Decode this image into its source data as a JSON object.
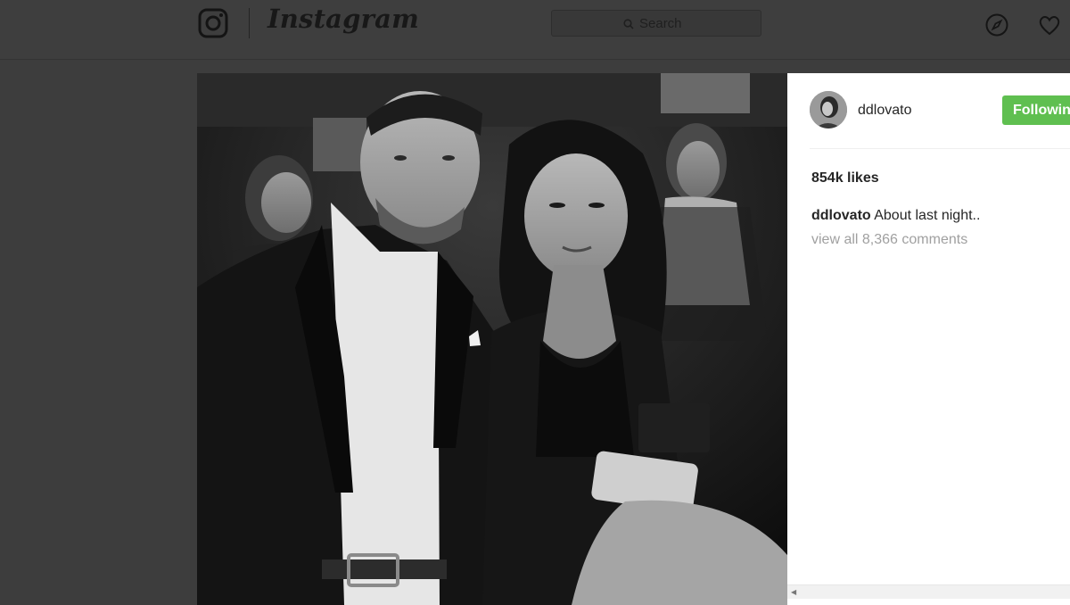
{
  "topnav": {
    "brand": "Instagram",
    "search_placeholder": "Search",
    "icons": [
      "instagram-camera-icon",
      "search-icon",
      "compass-icon",
      "heart-icon"
    ]
  },
  "post": {
    "username": "ddlovato",
    "follow_label": "Following",
    "likes": "854k likes",
    "caption_user": "ddlovato",
    "caption_text": "About last night..",
    "comments_link": "view all 8,366 comments"
  },
  "colors": {
    "follow_green": "#5fbf50",
    "backdrop": "#3d3d3d",
    "text_dark": "#262626",
    "text_muted": "#a0a0a0"
  }
}
